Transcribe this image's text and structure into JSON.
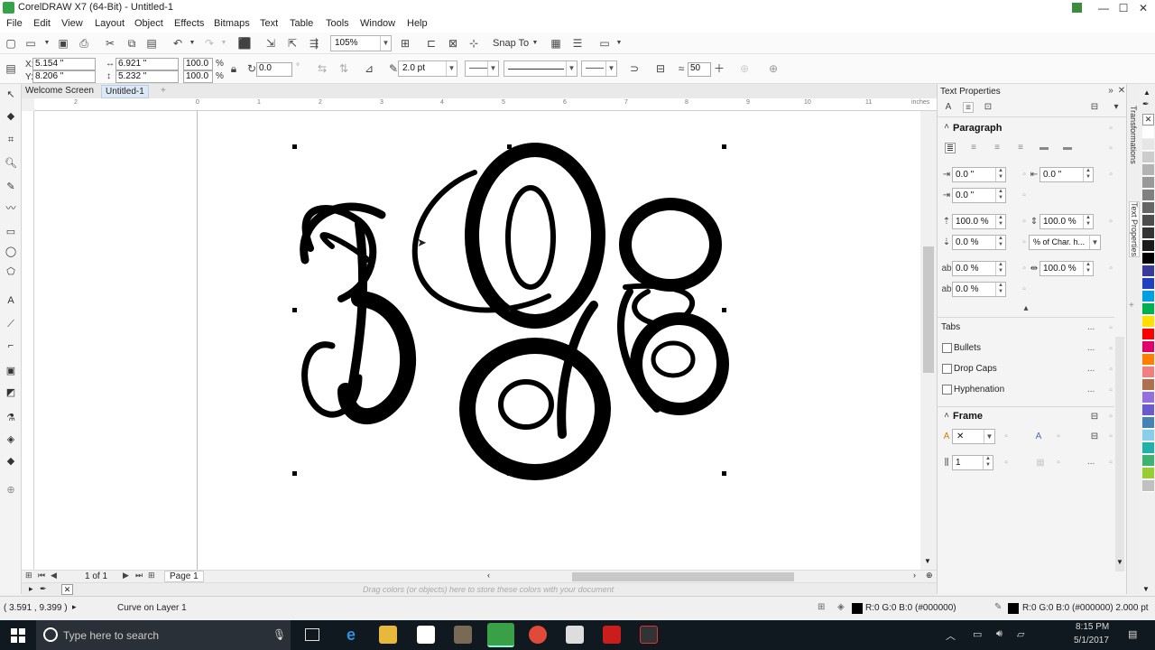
{
  "window": {
    "title": "CorelDRAW X7 (64-Bit) - Untitled-1",
    "minimize": "—",
    "maximize": "☐",
    "close": "✕"
  },
  "menu": [
    "File",
    "Edit",
    "View",
    "Layout",
    "Object",
    "Effects",
    "Bitmaps",
    "Text",
    "Table",
    "Tools",
    "Window",
    "Help"
  ],
  "toolbar": {
    "zoom_value": "105%",
    "snap_to": "Snap To"
  },
  "property_bar": {
    "x_label": "X:",
    "x_value": "5.154 \"",
    "y_label": "Y:",
    "y_value": "8.206 \"",
    "width_value": "6.921 \"",
    "height_value": "5.232 \"",
    "scale_x": "100.0",
    "scale_y": "100.0",
    "percent": "%",
    "rotation": "0.0",
    "degree": "°",
    "outline_width": "2.0 pt",
    "line_style": "——",
    "smoothing": "50"
  },
  "document_tabs": [
    "Welcome Screen",
    "Untitled-1"
  ],
  "ruler": {
    "units": "inches",
    "h_ticks": [
      "2",
      "0",
      "2",
      "4",
      "6",
      "8",
      "10"
    ],
    "h_ticks_numeric": [
      "1",
      "3",
      "5",
      "7",
      "9",
      "11"
    ]
  },
  "page_nav": {
    "counter": "1 of 1",
    "page_tab": "Page 1"
  },
  "color_tray_hint": "Drag colors (or objects) here to store these colors with your document",
  "text_properties": {
    "panel_title": "Text Properties",
    "paragraph": {
      "heading": "Paragraph",
      "left_indent": "0.0 \"",
      "right_indent": "0.0 \"",
      "first_line": "0.0 \"",
      "line_spacing": "100.0 %",
      "before_para": "100.0 %",
      "char_spacing": "0.0 %",
      "spacing_unit": "% of Char. h...",
      "word_spacing": "0.0 %",
      "lang_spacing": "100.0 %",
      "indent_extra": "0.0 %",
      "tabs": "Tabs",
      "bullets": "Bullets",
      "drop_caps": "Drop Caps",
      "hyphenation": "Hyphenation",
      "more": "..."
    },
    "frame": {
      "heading": "Frame",
      "columns": "1"
    }
  },
  "docker_tabs": [
    "Transformations",
    "Text Properties"
  ],
  "status": {
    "cursor_position": "( 3.591 , 9.399 )",
    "object_info": "Curve on Layer 1",
    "fill_info": "R:0 G:0 B:0 (#000000)",
    "outline_info": "R:0 G:0 B:0 (#000000)  2.000 pt"
  },
  "taskbar": {
    "search_placeholder": "Type here to search",
    "time": "8:15 PM",
    "date": "5/1/2017"
  },
  "palette_colors": [
    "#ffffff",
    "#e6e6e6",
    "#cccccc",
    "#b3b3b3",
    "#999999",
    "#808080",
    "#666666",
    "#4d4d4d",
    "#333333",
    "#1a1a1a",
    "#000000",
    "#3a3a9a",
    "#2040c0",
    "#00a0e0",
    "#00b050",
    "#ffe000",
    "#ff0000",
    "#e0006a",
    "#ff8000",
    "#f08080",
    "#b07050",
    "#9370db",
    "#6a5acd",
    "#4682b4",
    "#87ceeb",
    "#20b2aa",
    "#3cb371",
    "#9acd32",
    "#c0c0c0"
  ]
}
